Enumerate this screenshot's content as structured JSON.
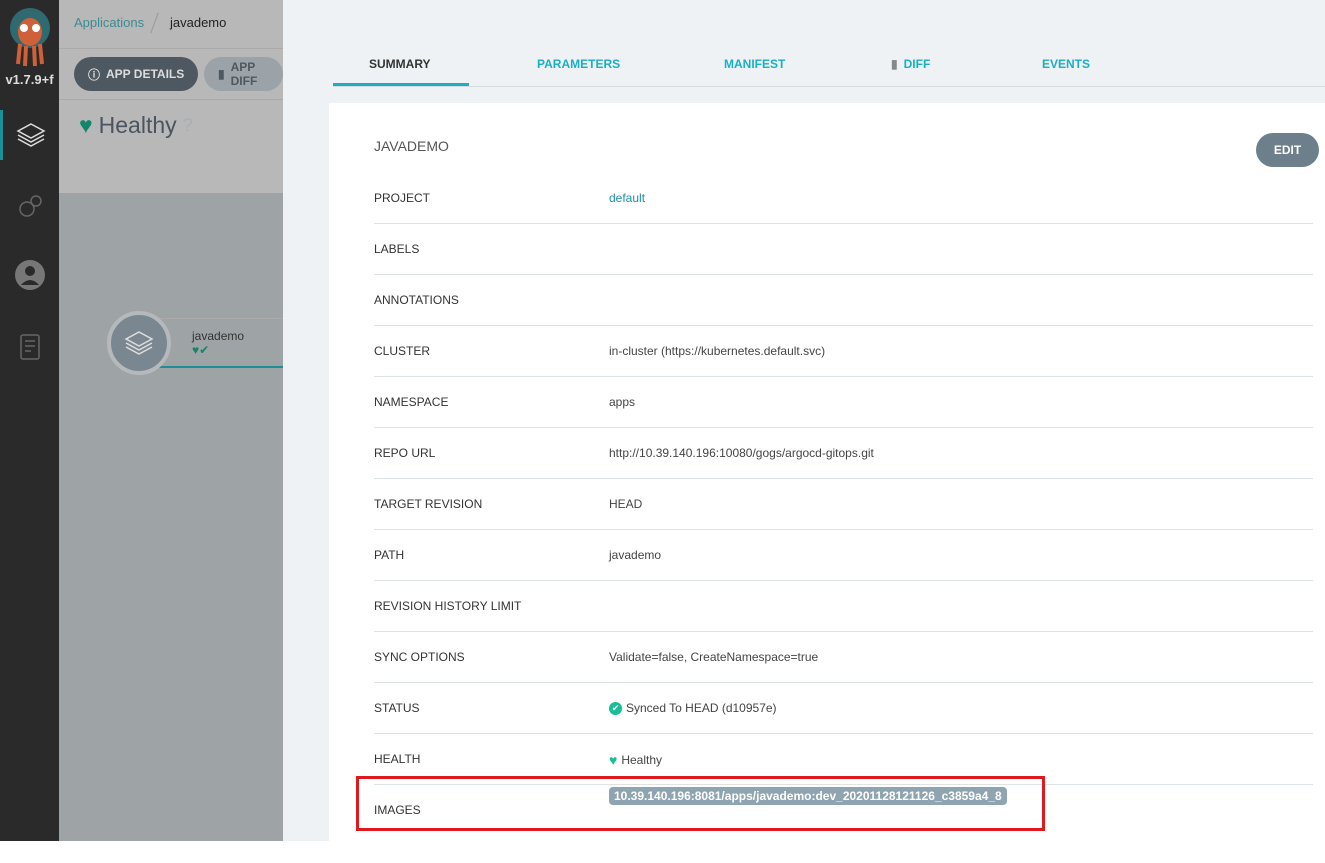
{
  "sidebar": {
    "version": "v1.7.9+f",
    "items": [
      "applications",
      "settings",
      "user-info",
      "docs"
    ]
  },
  "background": {
    "breadcrumb": [
      "Applications",
      "javademo"
    ],
    "buttons": [
      "APP DETAILS",
      "APP DIFF"
    ],
    "health": "Healthy",
    "node_name": "javademo"
  },
  "tabs": [
    "SUMMARY",
    "PARAMETERS",
    "MANIFEST",
    "DIFF",
    "EVENTS"
  ],
  "card": {
    "title": "JAVADEMO",
    "edit_label": "EDIT",
    "rows": [
      {
        "key": "PROJECT",
        "value": "default"
      },
      {
        "key": "LABELS",
        "value": ""
      },
      {
        "key": "ANNOTATIONS",
        "value": ""
      },
      {
        "key": "CLUSTER",
        "value": "in-cluster (https://kubernetes.default.svc)"
      },
      {
        "key": "NAMESPACE",
        "value": "apps"
      },
      {
        "key": "REPO URL",
        "value": "http://10.39.140.196:10080/gogs/argocd-gitops.git"
      },
      {
        "key": "TARGET REVISION",
        "value": "HEAD"
      },
      {
        "key": "PATH",
        "value": "javademo"
      },
      {
        "key": "REVISION HISTORY LIMIT",
        "value": ""
      },
      {
        "key": "SYNC OPTIONS",
        "value": "Validate=false, CreateNamespace=true"
      },
      {
        "key": "STATUS",
        "value": "Synced To HEAD (d10957e)"
      },
      {
        "key": "HEALTH",
        "value": "Healthy"
      },
      {
        "key": "IMAGES",
        "value": "10.39.140.196:8081/apps/javademo:dev_20201128121126_c3859a4_8"
      }
    ]
  },
  "colors": {
    "accent": "#1ab0c4",
    "healthy": "#18be94",
    "highlight": "#e0191f"
  }
}
